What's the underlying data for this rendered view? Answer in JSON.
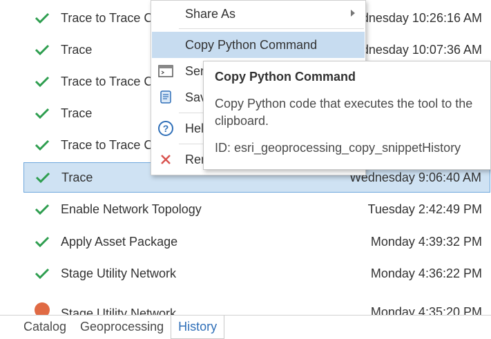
{
  "history": {
    "rows": [
      {
        "name": "Trace to Trace C",
        "time": "dnesday 10:26:16 AM",
        "status": "success"
      },
      {
        "name": "Trace",
        "time": "dnesday 10:07:36 AM",
        "status": "success"
      },
      {
        "name": "Trace to Trace C",
        "time": "",
        "status": "success"
      },
      {
        "name": "Trace",
        "time": "",
        "status": "success"
      },
      {
        "name": "Trace to Trace C",
        "time": "",
        "status": "success"
      },
      {
        "name": "Trace",
        "time": "Wednesday 9:06:40 AM",
        "status": "success",
        "selected": true
      },
      {
        "name": "Enable Network Topology",
        "time": "Tuesday 2:42:49 PM",
        "status": "success"
      },
      {
        "name": "Apply Asset Package",
        "time": "Monday 4:39:32 PM",
        "status": "success"
      },
      {
        "name": "Stage Utility Network",
        "time": "Monday 4:36:22 PM",
        "status": "success"
      },
      {
        "name": "Stage Utility Network",
        "time": "Monday 4:35:20 PM",
        "status": "error"
      }
    ]
  },
  "context_menu": {
    "items": [
      {
        "label": "Share As",
        "icon": "none",
        "has_submenu": true
      },
      {
        "label": "Copy Python Command",
        "icon": "none",
        "highlighted": true
      },
      {
        "label": "Ser",
        "icon": "window-icon"
      },
      {
        "label": "Sav",
        "icon": "script-icon"
      },
      {
        "label": "Hel",
        "icon": "help-icon"
      },
      {
        "label": "Rer",
        "icon": "remove-icon"
      }
    ]
  },
  "tooltip": {
    "title": "Copy Python Command",
    "description": "Copy Python code that executes the tool to the clipboard.",
    "id_text": "ID: esri_geoprocessing_copy_snippetHistory"
  },
  "tabs": {
    "items": [
      {
        "label": "Catalog"
      },
      {
        "label": "Geoprocessing"
      },
      {
        "label": "History",
        "active": true
      }
    ]
  },
  "colors": {
    "success": "#2e9e4f",
    "error": "#e06a44",
    "selected_bg": "#cfe2f3",
    "accent": "#2f6fb8"
  }
}
